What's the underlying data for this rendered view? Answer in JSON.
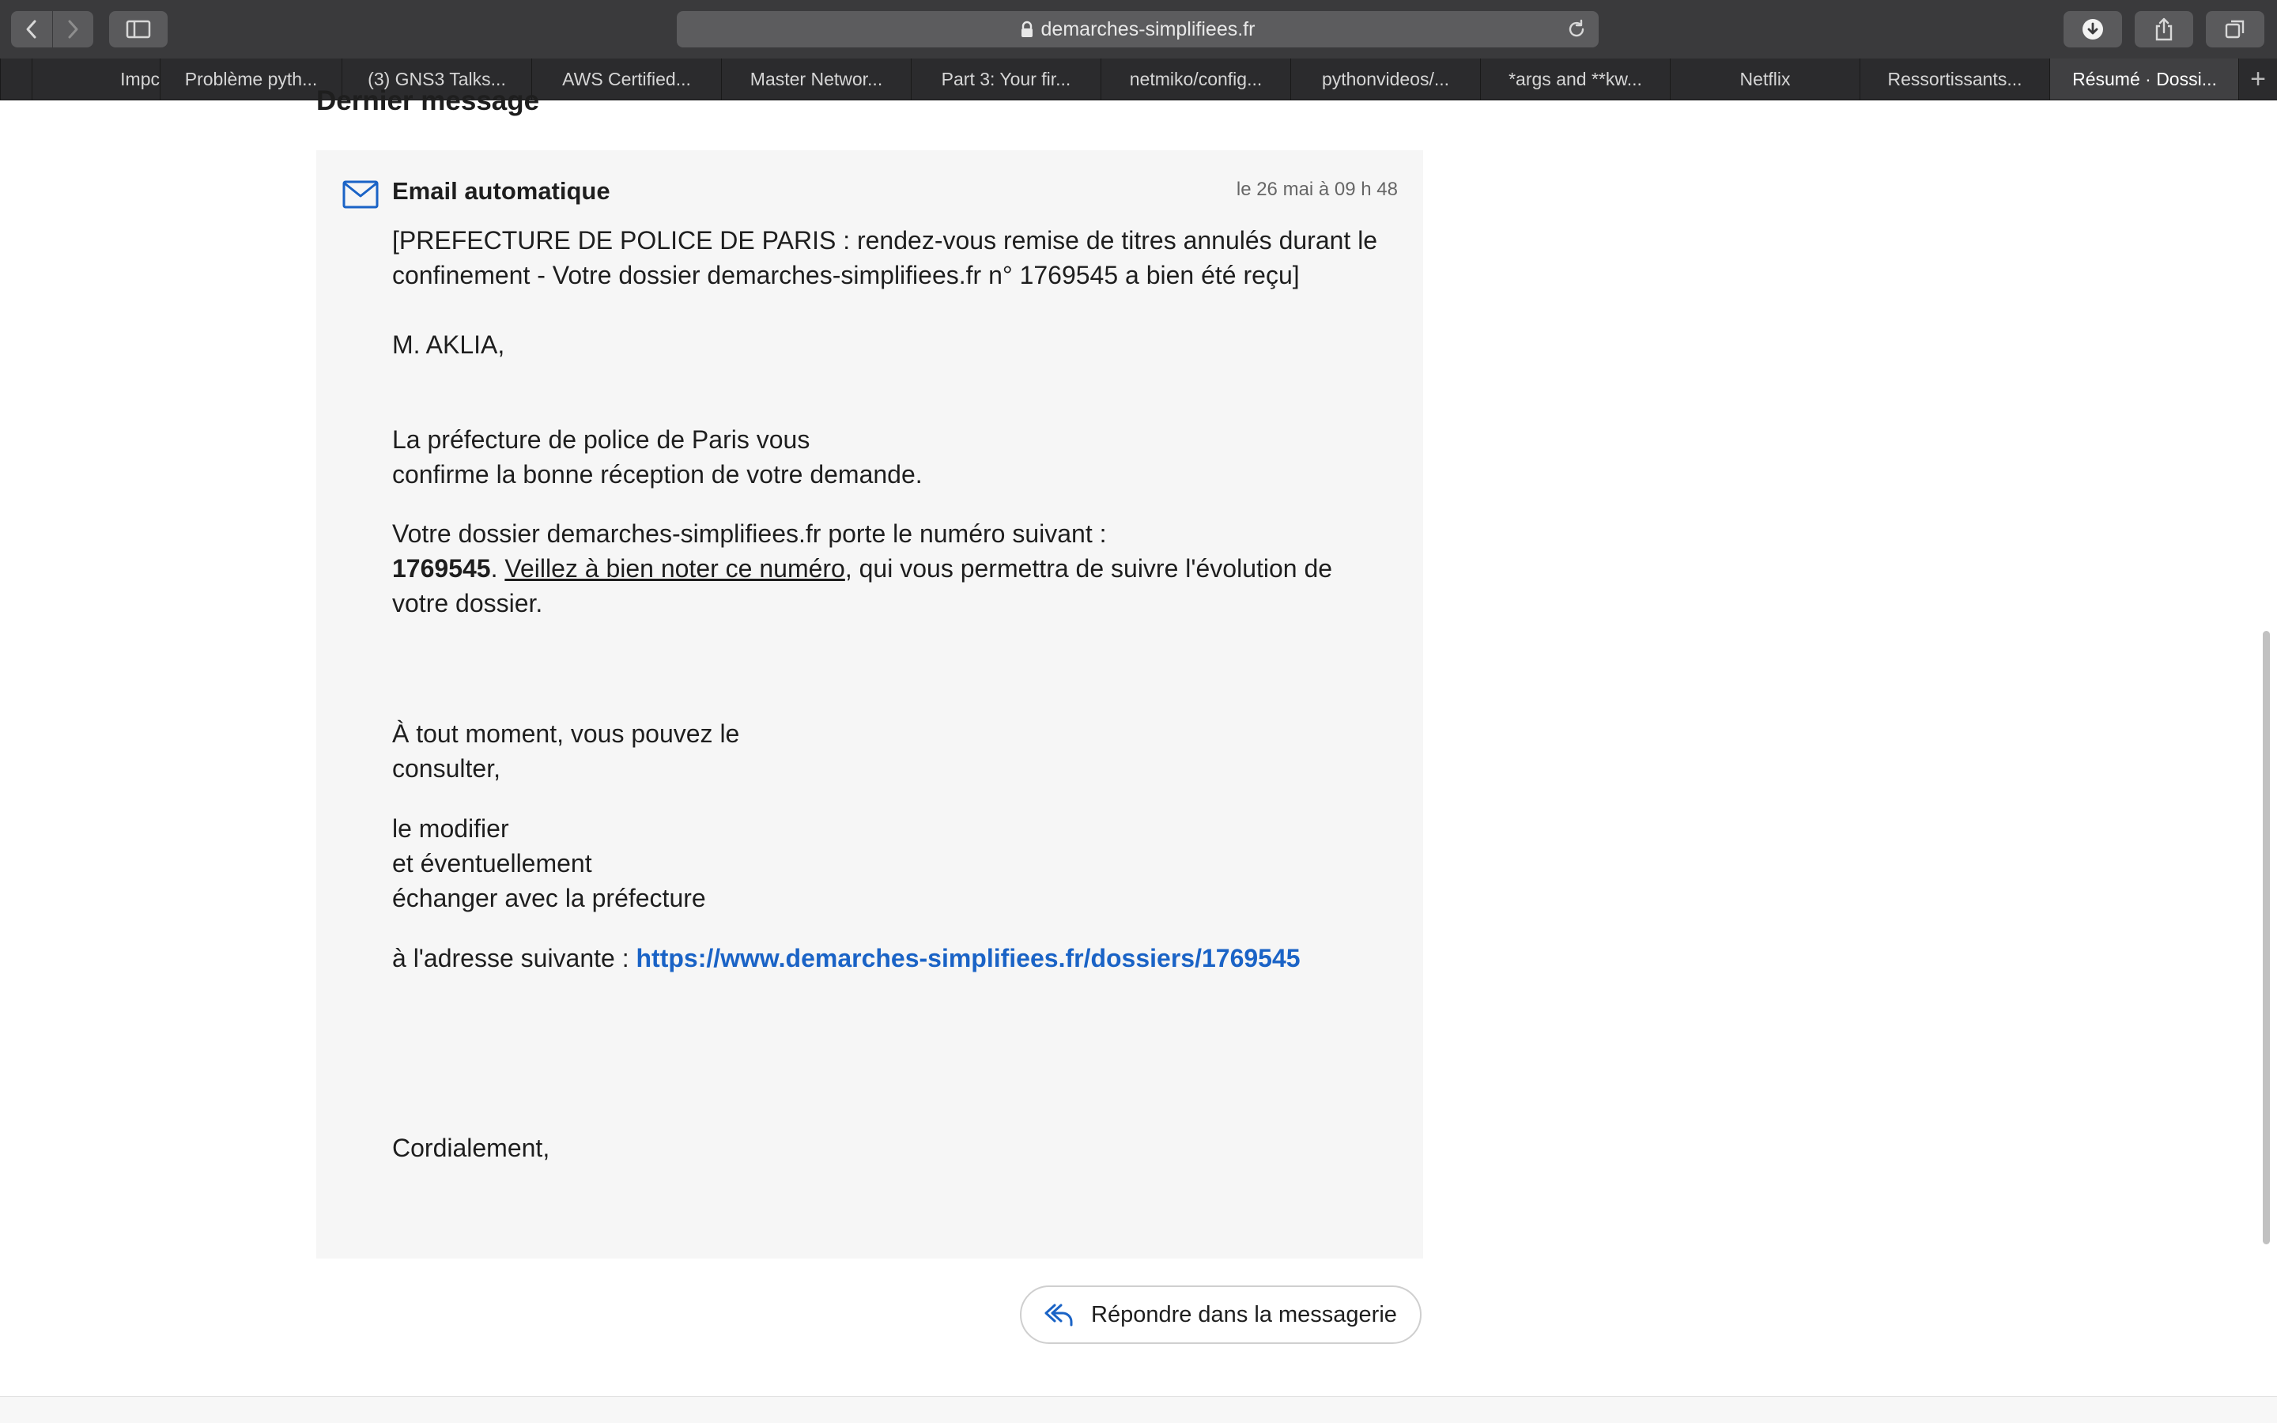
{
  "browser": {
    "url": "demarches-simplifiees.fr",
    "tabs": [
      {
        "label": ""
      },
      {
        "label": "Impc"
      },
      {
        "label": "Problème pyth..."
      },
      {
        "label": "(3) GNS3 Talks..."
      },
      {
        "label": "AWS Certified..."
      },
      {
        "label": "Master Networ..."
      },
      {
        "label": "Part 3: Your fir..."
      },
      {
        "label": "netmiko/config..."
      },
      {
        "label": "pythonvideos/..."
      },
      {
        "label": "*args and **kw..."
      },
      {
        "label": "Netflix"
      },
      {
        "label": "Ressortissants..."
      },
      {
        "label": "Résumé · Dossi..."
      }
    ],
    "new_tab": "+"
  },
  "page": {
    "section_title": "Dernier message",
    "message": {
      "sender": "Email automatique",
      "date": "le 26 mai à 09 h 48",
      "subject_line1": "[PREFECTURE DE POLICE DE PARIS : rendez-vous remise de titres annulés durant le",
      "subject_line2": "confinement - Votre dossier demarches-simplifiees.fr n° 1769545 a bien été reçu]",
      "greeting": "M. AKLIA,",
      "confirm_line1": "La préfecture de police de Paris vous",
      "confirm_line2": "confirme la bonne réception de votre demande.",
      "dossier_line1": "Votre dossier demarches-simplifiees.fr porte le numéro suivant :",
      "dossier_number": "1769545",
      "dossier_period": ". ",
      "dossier_note": "Veillez à bien noter ce numéro",
      "dossier_rest": ", qui vous permettra de suivre l'évolution de",
      "dossier_line3": "votre dossier.",
      "moment_line1": "À tout moment, vous pouvez le",
      "moment_line2": "consulter,",
      "modify_line1": "le modifier",
      "modify_line2": "et éventuellement",
      "modify_line3": "échanger avec la préfecture",
      "address_label": "à l'adresse suivante : ",
      "address_link": "https://www.demarches-simplifiees.fr/dossiers/1769545",
      "closing": "Cordialement,"
    },
    "reply_button": "Répondre dans la messagerie"
  },
  "colors": {
    "link": "#1a63c6",
    "message_bg": "#f6f6f6",
    "chrome_bg": "#3a3a3c"
  },
  "icons": [
    "back-icon",
    "forward-icon",
    "sidebar-icon",
    "lock-icon",
    "reload-icon",
    "download-icon",
    "share-icon",
    "tabs-icon",
    "mail-icon",
    "reply-icon"
  ]
}
